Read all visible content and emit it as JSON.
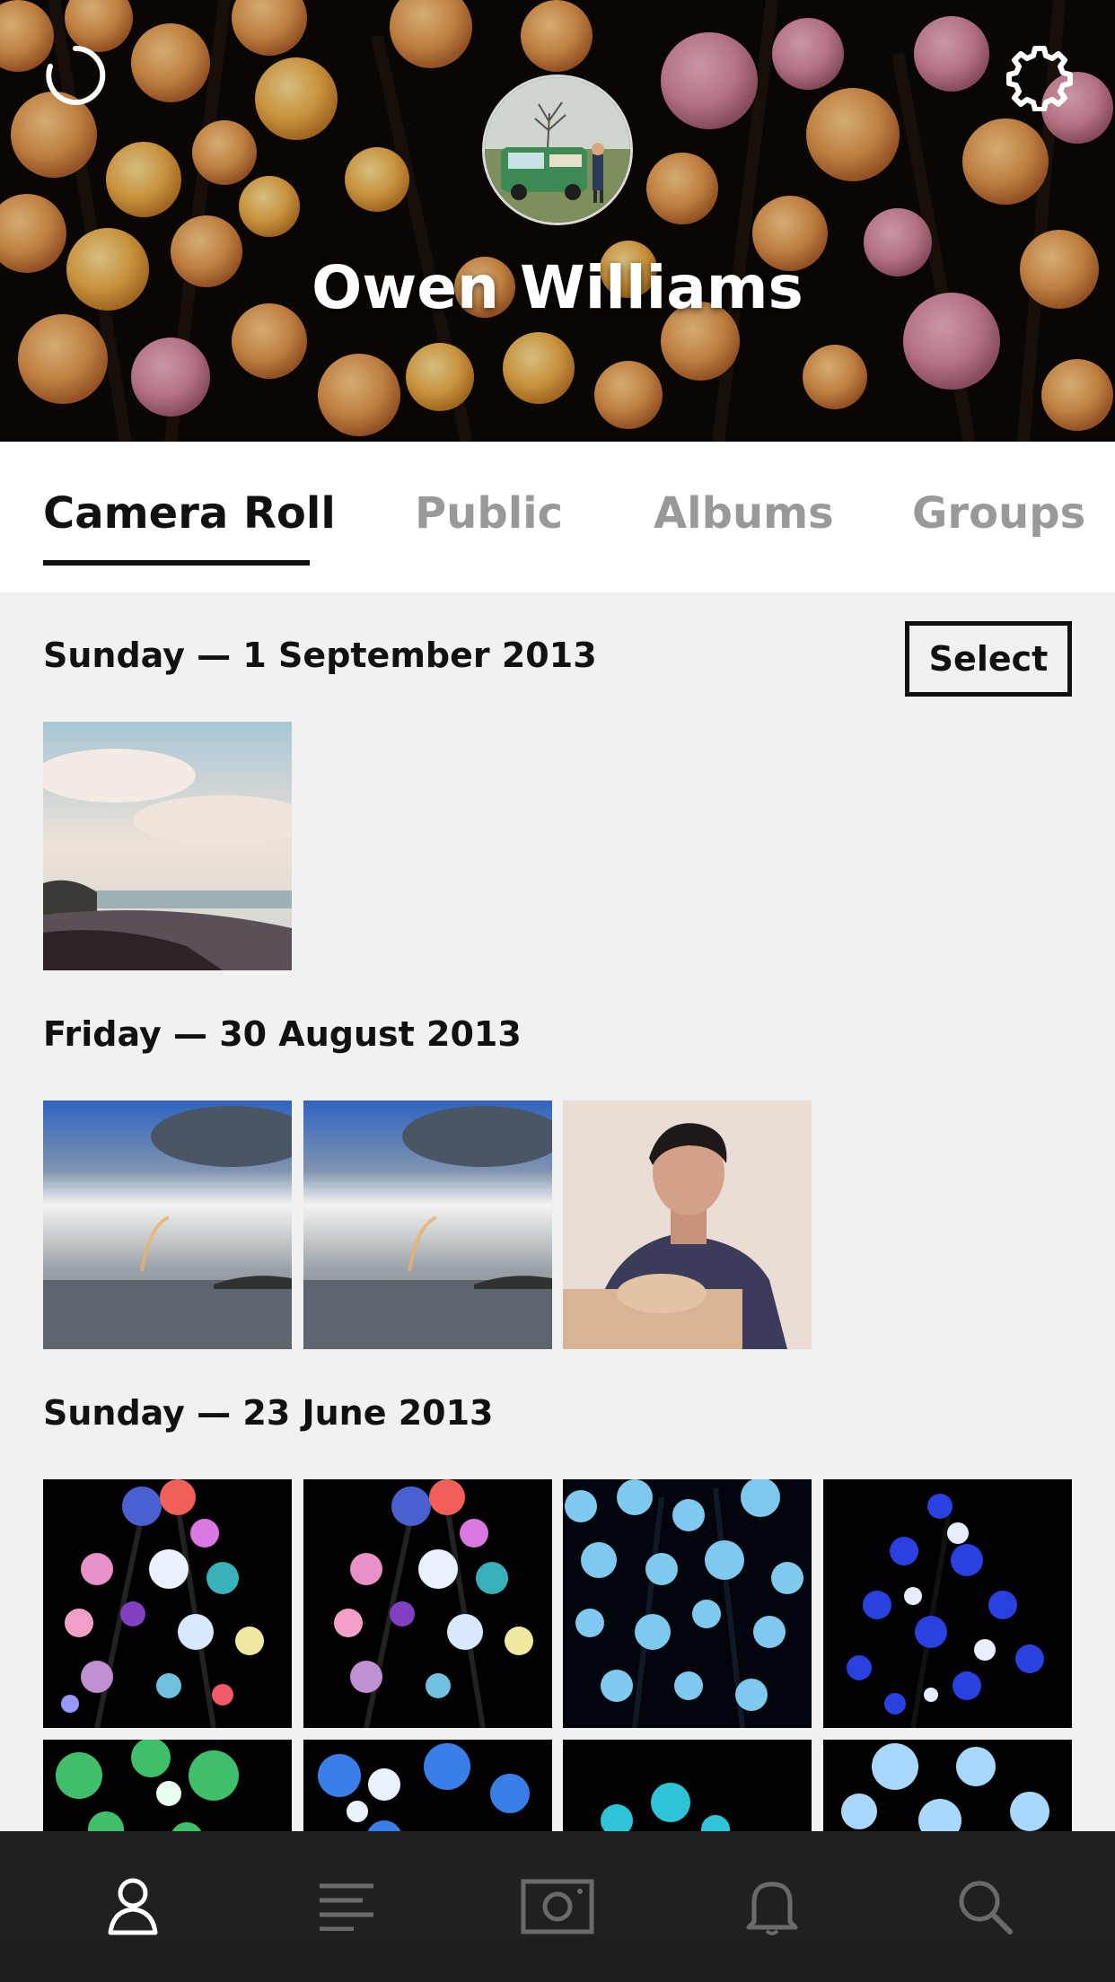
{
  "header": {
    "profile_name": "Owen Williams",
    "left_icon": "sync-icon",
    "right_icon": "gear-icon"
  },
  "tabs": [
    {
      "label": "Camera Roll",
      "active": true
    },
    {
      "label": "Public",
      "active": false
    },
    {
      "label": "Albums",
      "active": false
    },
    {
      "label": "Groups",
      "active": false
    }
  ],
  "sections": [
    {
      "date": "Sunday — 1 September 2013",
      "action": "Select",
      "photo_count": 1
    },
    {
      "date": "Friday — 30 August 2013",
      "photo_count": 3
    },
    {
      "date": "Sunday — 23 June 2013",
      "photo_count": 8
    }
  ],
  "bottom_nav": [
    {
      "icon": "profile-icon",
      "active": true
    },
    {
      "icon": "feed-icon",
      "active": false
    },
    {
      "icon": "camera-icon",
      "active": false
    },
    {
      "icon": "notifications-icon",
      "active": false
    },
    {
      "icon": "search-icon",
      "active": false
    }
  ],
  "colors": {
    "background": "#f1f1f1",
    "tab_active": "#111111",
    "tab_inactive": "#999999",
    "bottom_bar": "#121212"
  }
}
